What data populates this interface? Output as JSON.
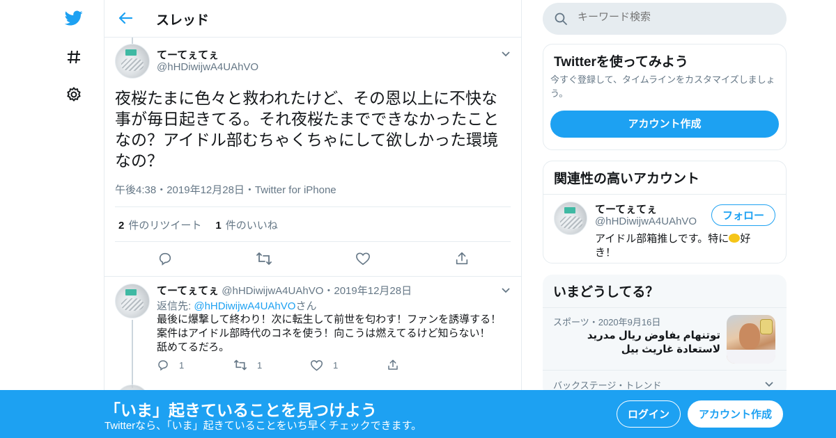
{
  "header": {
    "title": "スレッド"
  },
  "focal_tweet": {
    "name": "てーてぇてぇ",
    "handle": "@hHDiwijwA4UAhVO",
    "text": "夜桜たまに色々と救われたけど、その恩以上に不快な事が毎日起きてる。それ夜桜たまでできなかったことなの？アイドル部むちゃくちゃにして欲しかった環境なの？",
    "meta": "午後4:38・2019年12月28日・Twitter for iPhone",
    "retweet_count": "2",
    "retweet_label": "件のリツイート",
    "like_count": "1",
    "like_label": "件のいいね"
  },
  "reply_tweet": {
    "name": "てーてぇてぇ",
    "handle_date": "@hHDiwijwA4UAhVO・2019年12月28日",
    "replying_prefix": "返信先:",
    "replying_handle": "@hHDiwijwA4UAhVO",
    "replying_suffix": "さん",
    "text_line1": "最後に爆撃して終わり！次に転生して前世を匂わす！ファンを誘導する！",
    "text_line2": "案件はアイドル部時代のコネを使う！向こうは燃えてるけど知らない！",
    "text_line3": "舐めてるだろ。",
    "reply_count": "1",
    "retweet_count": "1",
    "like_count": "1"
  },
  "search": {
    "placeholder": "キーワード検索"
  },
  "try_card": {
    "title": "Twitterを使ってみよう",
    "desc": "今すぐ登録して、タイムラインをカスタマイズしましょう。",
    "button": "アカウント作成"
  },
  "related_card": {
    "title": "関連性の高いアカウント",
    "name": "てーてぇてぇ",
    "handle": "@hHDiwijwA4UAhVO",
    "bio_before": "アイドル部箱推しです。特に",
    "bio_after": "好き！",
    "follow_label": "フォロー"
  },
  "trends_card": {
    "title": "いまどうしてる？",
    "item1_meta": "スポーツ・2020年9月16日",
    "item1_title": "توتنهام يفاوض ريال مدريد لاستعادة غاريث بيل",
    "item2_meta": "バックステージ・トレンド"
  },
  "banner": {
    "title": "「いま」起きていることを見つけよう",
    "subtitle": "Twitterなら、「いま」起きていることをいち早くチェックできます。",
    "login": "ログイン",
    "signup": "アカウント作成"
  },
  "colors": {
    "accent": "#1da1f2",
    "muted": "#657786",
    "border": "#e6ecf0"
  }
}
